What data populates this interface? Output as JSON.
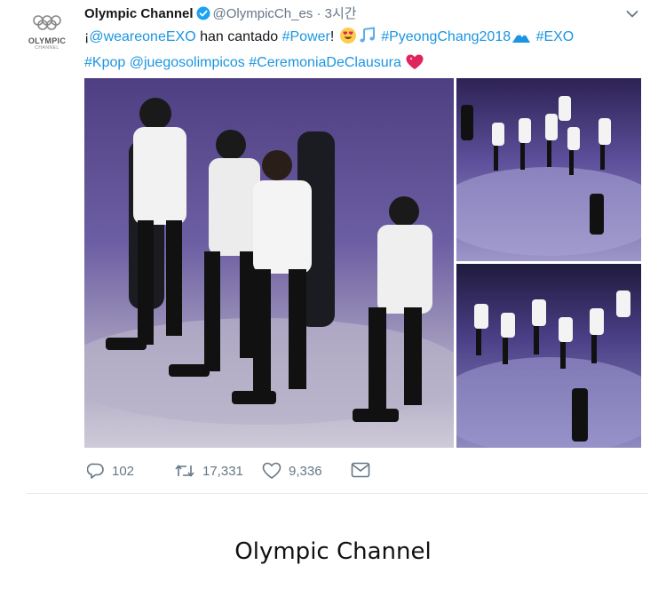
{
  "tweet": {
    "account_name": "Olympic Channel",
    "handle": "@OlympicCh_es",
    "separator": "·",
    "time": "3시간",
    "avatar": {
      "logo_text": "OLYMPIC",
      "logo_sub": "CHANNEL",
      "icon": "olympic-rings-icon"
    },
    "text": {
      "p1": "¡",
      "mention1": "@weareoneEXO",
      "p2": " han cantado ",
      "hashtag1": "#Power",
      "p3": "! ",
      "hashtag2": "#PyeongChang2018",
      "hashtag3": "#EXO",
      "hashtag4": "#Kpop",
      "mention2": "@juegosolimpicos",
      "hashtag5": "#CeremoniaDeClausura"
    },
    "actions": {
      "replies": "102",
      "retweets": "17,331",
      "likes": "9,336"
    }
  },
  "caption": "Olympic Channel",
  "colors": {
    "link": "#1b95e0",
    "secondary_text": "#657786",
    "verified": "#1da1f2"
  }
}
